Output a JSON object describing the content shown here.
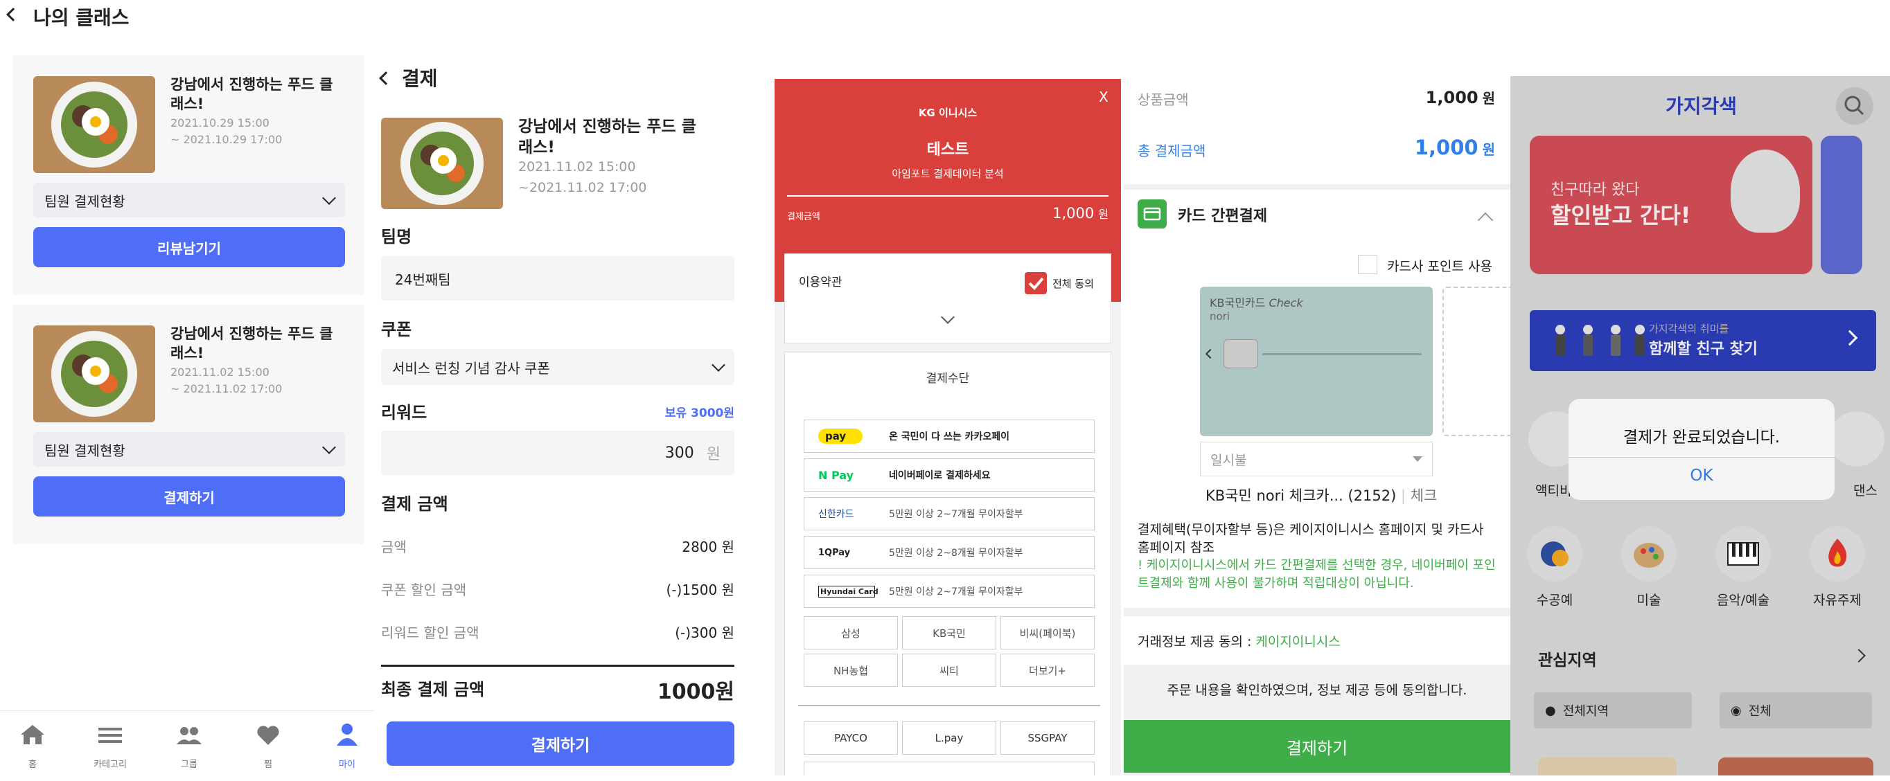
{
  "panel1": {
    "title": "나의 클래스",
    "cards": [
      {
        "title": "강남에서 진행하는 푸드 클래스!",
        "start": "2021.10.29 15:00",
        "end": "~ 2021.10.29 17:00",
        "dropdown": "팀원 결제현황",
        "button": "리뷰남기기"
      },
      {
        "title": "강남에서 진행하는 푸드 클래스!",
        "start": "2021.11.02 15:00",
        "end": "~ 2021.11.02 17:00",
        "dropdown": "팀원 결제현황",
        "button": "결제하기"
      }
    ],
    "nav": [
      {
        "label": "홈",
        "icon": "home-icon"
      },
      {
        "label": "카테고리",
        "icon": "menu-icon"
      },
      {
        "label": "그룹",
        "icon": "group-icon"
      },
      {
        "label": "찜",
        "icon": "heart-icon"
      },
      {
        "label": "마이",
        "icon": "user-icon"
      }
    ],
    "active_color": "#4f6ef7"
  },
  "panel2": {
    "title": "결제",
    "class_title": "강남에서 진행하는 푸드 클래스!",
    "class_start": "2021.11.02 15:00",
    "class_end": "~2021.11.02 17:00",
    "team_label": "팀명",
    "team_value": "24번째팀",
    "coupon_label": "쿠폰",
    "coupon_value": "서비스 런칭 기념 감사 쿠폰",
    "reward_label": "리워드",
    "reward_owned": "보유 3000원",
    "reward_value": "300",
    "reward_unit": "원",
    "pay_amount_label": "결제 금액",
    "rows": [
      {
        "label": "금액",
        "value": "2800 원"
      },
      {
        "label": "쿠폰 할인 금액",
        "value": "(-)1500 원"
      },
      {
        "label": "리워드 할인 금액",
        "value": "(-)300 원"
      }
    ],
    "final_label": "최종 결제 금액",
    "final_value": "1000원",
    "pay_button": "결제하기"
  },
  "panel3": {
    "logo": "KG 이니시스",
    "close": "X",
    "merchant": "테스트",
    "merchant_sub": "아임포트 결제데이터 분석",
    "amount_label": "결제금액",
    "amount_value": "1,000",
    "amount_unit": "원",
    "terms_label": "이용약관",
    "agree_all": "전체 동의",
    "method_title": "결제수단",
    "methods": [
      {
        "brand": "pay",
        "text": "온 국민이 다 쓰는 카카오페이"
      },
      {
        "brand": "N Pay",
        "text": "네이버페이로 결제하세요"
      },
      {
        "brand": "신한카드",
        "text": "5만원 이상 2~7개월 무이자할부"
      },
      {
        "brand": "1QPay",
        "text": "5만원 이상 2~8개월 무이자할부"
      },
      {
        "brand": "Hyundai Card",
        "text": "5만원 이상 2~7개월 무이자할부"
      }
    ],
    "banks": [
      "삼성",
      "KB국민",
      "비씨(페이북)",
      "NH농협",
      "씨티",
      "더보기+"
    ],
    "easy": [
      "PAYCO",
      "L.pay",
      "SSGPAY"
    ],
    "brand_color": "#d9403b"
  },
  "panel4": {
    "product_label": "상품금액",
    "product_value": "1,000",
    "product_unit": "원",
    "total_label": "총 결제금액",
    "total_value": "1,000",
    "total_unit": "원",
    "card_pay_title": "카드 간편결제",
    "point_use": "카드사 포인트 사용",
    "card_brand": "KB국민카드",
    "card_type": "Check",
    "card_name": "nori",
    "installment": "일시불",
    "card_desc_main": "KB국민 nori 체크카...",
    "card_desc_num": "(2152)",
    "card_desc_type": "체크",
    "benefit_text": "결제혜택(무이자할부 등)은 케이지이니시스 홈페이지 및 카드사 홈페이지 참조",
    "warning_text": "! 케이지이니시스에서 카드 간편결제를 선택한 경우, 네이버페이 포인트결제와 함께 사용이 불가하며 적립대상이 아닙니다.",
    "consent_label": "거래정보 제공 동의 :",
    "consent_link": "케이지이니시스",
    "confirm_text": "주문 내용을 확인하였으며, 정보 제공 등에 동의합니다.",
    "pay_button": "결제하기",
    "green": "#3fae49"
  },
  "panel5": {
    "logo": "가지각색",
    "banner_small": "친구따라 왔다",
    "banner_big": "할인받고 간다!",
    "friend_small": "가지각색의 취미를",
    "friend_big": "함께할 친구 찾기",
    "partial_left": "액티비",
    "partial_right": "댄스",
    "categories": [
      "수공예",
      "미술",
      "음악/예술",
      "자유주제"
    ],
    "interest_title": "관심지역",
    "filter_region": "전체지역",
    "filter_all": "전체",
    "alert_text": "결제가 완료되었습니다.",
    "alert_ok": "OK"
  }
}
